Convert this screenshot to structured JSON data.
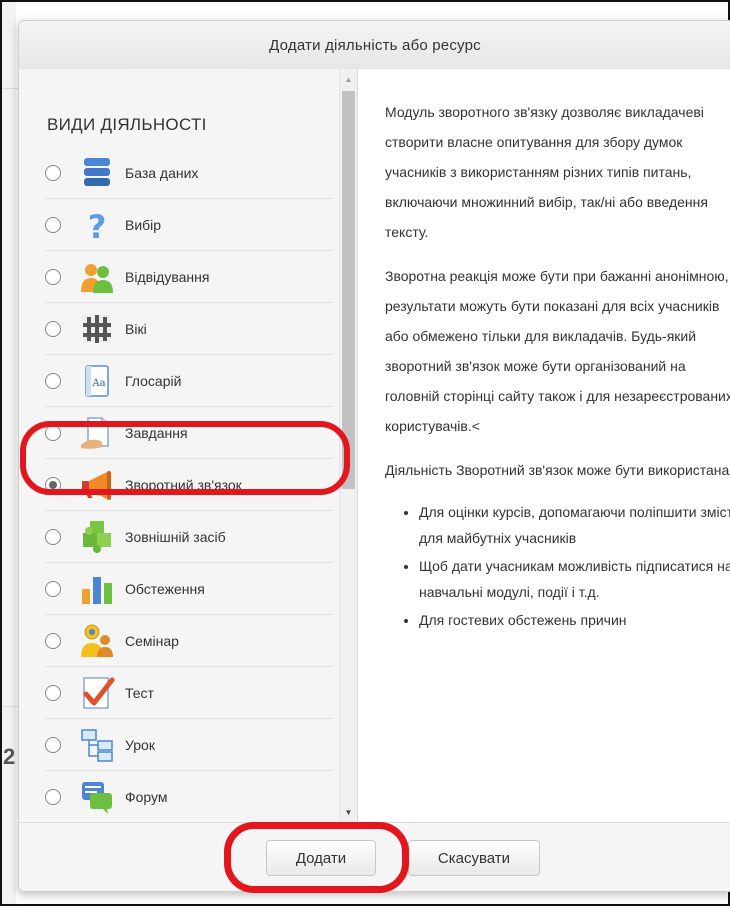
{
  "dialog": {
    "title": "Додати діяльність або ресурс"
  },
  "activities": {
    "section_title": "ВИДИ ДІЯЛЬНОСТІ",
    "items": [
      {
        "label": "База даних",
        "icon": "database-icon",
        "selected": false
      },
      {
        "label": "Вибір",
        "icon": "question-mark-icon",
        "selected": false
      },
      {
        "label": "Відвідування",
        "icon": "attendance-people-icon",
        "selected": false
      },
      {
        "label": "Вікі",
        "icon": "wiki-puzzle-icon",
        "selected": false
      },
      {
        "label": "Глосарій",
        "icon": "glossary-book-icon",
        "selected": false
      },
      {
        "label": "Завдання",
        "icon": "assignment-hand-icon",
        "selected": false
      },
      {
        "label": "Зворотний зв'язок",
        "icon": "megaphone-icon",
        "selected": true
      },
      {
        "label": "Зовнішній засіб",
        "icon": "puzzle-piece-icon",
        "selected": false
      },
      {
        "label": "Обстеження",
        "icon": "bar-chart-icon",
        "selected": false
      },
      {
        "label": "Семінар",
        "icon": "seminar-people-icon",
        "selected": false
      },
      {
        "label": "Тест",
        "icon": "quiz-checkmark-icon",
        "selected": false
      },
      {
        "label": "Урок",
        "icon": "lesson-tree-icon",
        "selected": false
      },
      {
        "label": "Форум",
        "icon": "forum-chat-icon",
        "selected": false
      }
    ]
  },
  "description": {
    "paragraphs": [
      "Модуль зворотного зв'язку дозволяє викладачеві створити власне опитування для збору думок учасників з використанням різних типів питань, включаючи множинний вибір, так/ні або введення тексту.",
      "Зворотна реакція може бути при бажанні анонімною, результати можуть бути показані для всіх учасників або обмежено тільки для викладачів. Будь-який зворотний зв'язок може бути організований на головній сторінці сайту також і для незареєстрованих користувачів.<",
      "Діяльність Зворотний зв'язок може бути використана"
    ],
    "bullets": [
      "Для оцінки курсів, допомагаючи поліпшити зміст для майбутніх учасників",
      "Щоб дати учасникам можливість підписатися на навчальні модулі, події і т.д.",
      "Для гостевих обстежень причин"
    ]
  },
  "footer": {
    "add_label": "Додати",
    "cancel_label": "Скасувати"
  },
  "background": {
    "partial_digit": "2"
  },
  "colors": {
    "highlight": "#e3151d",
    "panel_bg": "#f5f5f5"
  }
}
